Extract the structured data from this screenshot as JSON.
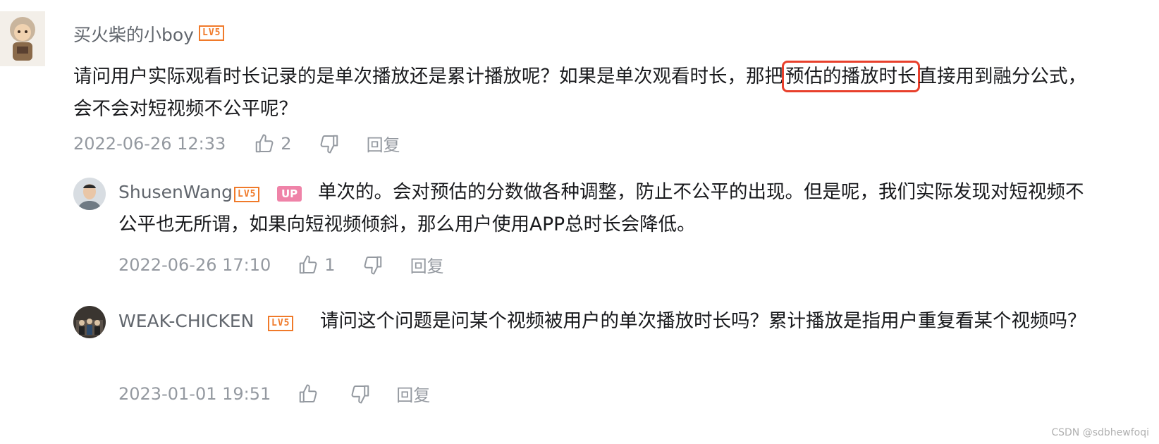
{
  "comments": [
    {
      "username": "买火柴的小boy",
      "level": "LV5",
      "text_before": "请问用户实际观看时长记录的是单次播放还是累计播放呢？如果是单次观看时长，那把",
      "text_highlight": "预估的播放时长",
      "text_after": "直接用到融分公式，会不会对短视频不公平呢？",
      "time": "2022-06-26 12:33",
      "likes": "2",
      "reply_label": "回复"
    }
  ],
  "replies": [
    {
      "username": "ShusenWang",
      "level": "LV5",
      "badge": "UP",
      "text": "单次的。会对预估的分数做各种调整，防止不公平的出现。但是呢，我们实际发现对短视频不公平也无所谓，如果向短视频倾斜，那么用户使用APP总时长会降低。",
      "time": "2022-06-26 17:10",
      "likes": "1",
      "reply_label": "回复"
    },
    {
      "username": "WEAK-CHICKEN",
      "level": "LV5",
      "text": "请问这个问题是问某个视频被用户的单次播放时长吗？累计播放是指用户重复看某个视频吗？",
      "time": "2023-01-01 19:51",
      "likes": "",
      "reply_label": "回复"
    }
  ],
  "watermark": "CSDN @sdbhewfoqi",
  "colors": {
    "highlight_border": "#e8402c",
    "level_badge": "#f07a2a",
    "up_badge": "#ef83a8",
    "meta_text": "#9499a0"
  },
  "icons": [
    "thumb-up-icon",
    "thumb-down-icon"
  ]
}
